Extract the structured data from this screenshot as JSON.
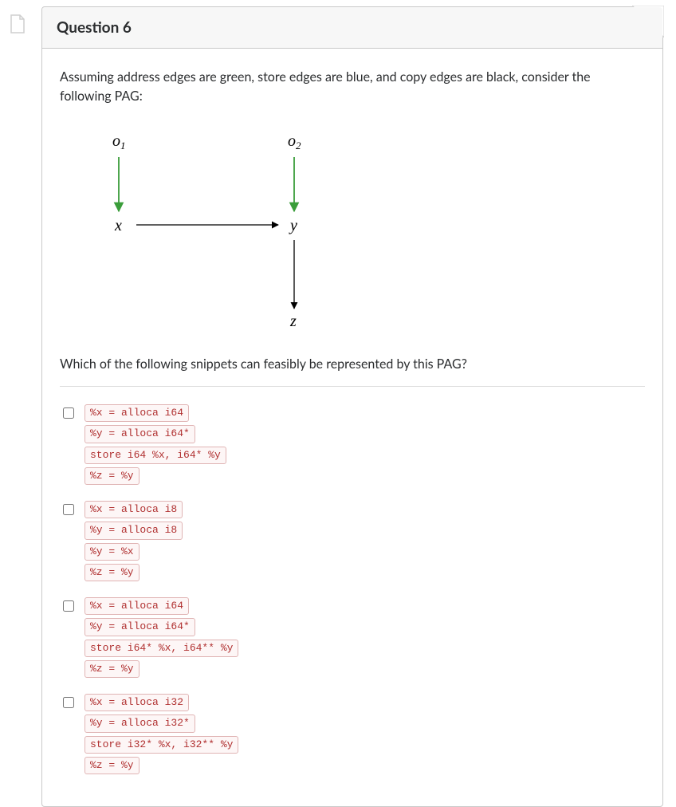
{
  "header": {
    "title": "Question 6"
  },
  "prompt": "Assuming address edges are green, store edges are blue, and copy edges are black, consider the following PAG:",
  "diagram": {
    "nodes": {
      "o1": "o",
      "o1sub": "1",
      "o2": "o",
      "o2sub": "2",
      "x": "x",
      "y": "y",
      "z": "z"
    }
  },
  "question2": "Which of the following snippets can feasibly be represented by this PAG?",
  "options": [
    {
      "id": "opt-a",
      "lines": [
        "%x = alloca i64",
        "%y = alloca i64*",
        "store i64 %x, i64* %y",
        "%z = %y"
      ]
    },
    {
      "id": "opt-b",
      "lines": [
        "%x = alloca i8",
        "%y = alloca i8",
        "%y = %x",
        "%z = %y"
      ]
    },
    {
      "id": "opt-c",
      "lines": [
        "%x = alloca i64",
        "%y = alloca i64*",
        "store i64* %x, i64** %y",
        "%z = %y"
      ]
    },
    {
      "id": "opt-d",
      "lines": [
        "%x = alloca i32",
        "%y = alloca i32*",
        "store i32* %x, i32** %y",
        "%z = %y"
      ]
    }
  ]
}
